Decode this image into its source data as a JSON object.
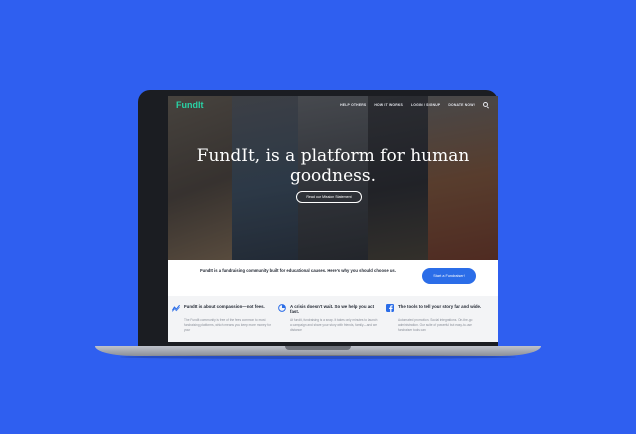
{
  "brand": {
    "name": "FundIt",
    "color": "#29d3a6"
  },
  "nav": {
    "items": [
      "HELP OTHERS",
      "HOW IT WORKS",
      "LOGIN / SIGNUP",
      "DONATE NOW!"
    ],
    "search_icon": "search-icon"
  },
  "hero": {
    "headline": "FundIt, is a platform for human goodness.",
    "button_label": "Read our Mission Statement"
  },
  "intro": {
    "text": "FundIt is a fundraising community built for educational causes. Here's why you should choose us.",
    "cta_label": "Start a Fundraiser!"
  },
  "features": [
    {
      "icon": "trend-line-icon",
      "title": "FundIt is about compassion—not fees.",
      "body": "The FundIt community is free of the fees common to most fundraising platforms, which means you keep more money for your"
    },
    {
      "icon": "pie-chart-icon",
      "title": "A crisis doesn't wait. So we help you act fast.",
      "body": "At fundit, fundraising is a snap. It takes only minutes to launch a campaign and share your story with friends, family—and we distance"
    },
    {
      "icon": "facebook-icon",
      "title": "The tools to tell your story far and wide.",
      "body": "Automated promotion. Social integrations. On-the-go administration. Our suite of powerful but easy-to-use fundraiser tools can"
    }
  ],
  "colors": {
    "background": "#2f5ff0",
    "accent": "#2b6de8"
  }
}
